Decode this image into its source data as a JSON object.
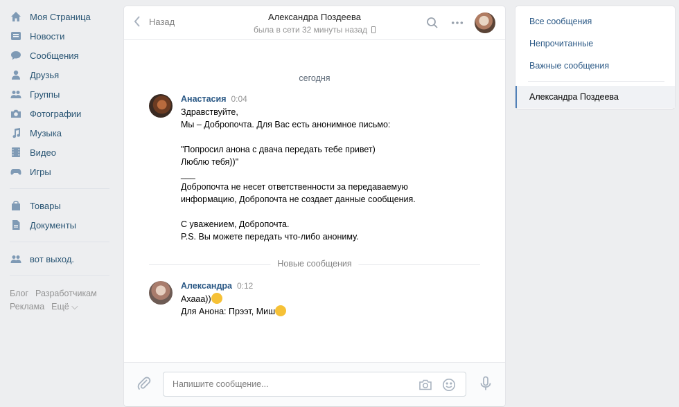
{
  "nav": {
    "items": [
      {
        "label": "Моя Страница",
        "icon": "home-icon"
      },
      {
        "label": "Новости",
        "icon": "news-icon"
      },
      {
        "label": "Сообщения",
        "icon": "messages-icon"
      },
      {
        "label": "Друзья",
        "icon": "friends-icon"
      },
      {
        "label": "Группы",
        "icon": "groups-icon"
      },
      {
        "label": "Фотографии",
        "icon": "camera-icon"
      },
      {
        "label": "Музыка",
        "icon": "music-icon"
      },
      {
        "label": "Видео",
        "icon": "video-icon"
      },
      {
        "label": "Игры",
        "icon": "gamepad-icon"
      }
    ],
    "items2": [
      {
        "label": "Товары",
        "icon": "bag-icon"
      },
      {
        "label": "Документы",
        "icon": "document-icon"
      }
    ],
    "items3": [
      {
        "label": "вот выход.",
        "icon": "group-icon"
      }
    ],
    "footer": [
      "Блог",
      "Разработчикам",
      "Реклама",
      "Ещё ⌵"
    ]
  },
  "header": {
    "back_label": "Назад",
    "peer_name": "Александра Поздеева",
    "peer_status": "была в сети 32 минуты назад"
  },
  "history": {
    "date": "сегодня",
    "new_messages_label": "Новые сообщения",
    "messages": [
      {
        "author": "Анастасия",
        "time": "0:04",
        "lines": [
          "Здравствуйте,",
          "Мы – Добропочта. Для Вас есть анонимное письмо:",
          "",
          "\"Попросил анона с двача передать тебе привет)",
          "Люблю тебя))\"",
          "___",
          "Добропочта не несет ответственности за передаваемую",
          "информацию, Добропочта не создает данные сообщения.",
          "",
          "С уважением, Добропочта.",
          "P.S. Вы можете передать что-либо анониму."
        ]
      },
      {
        "author": "Александра",
        "time": "0:12",
        "lines": [
          "Ахааа))",
          "Для Анона: Прээт, Миш"
        ]
      }
    ]
  },
  "composer": {
    "placeholder": "Напишите сообщение..."
  },
  "right_panel": {
    "items": [
      "Все сообщения",
      "Непрочитанные",
      "Важные сообщения"
    ],
    "active_dialog": "Александра Поздеева"
  },
  "colors": {
    "link": "#2a5885",
    "nav_text": "#285473",
    "icon": "#7f9ab5",
    "active_border": "#5181b8"
  }
}
